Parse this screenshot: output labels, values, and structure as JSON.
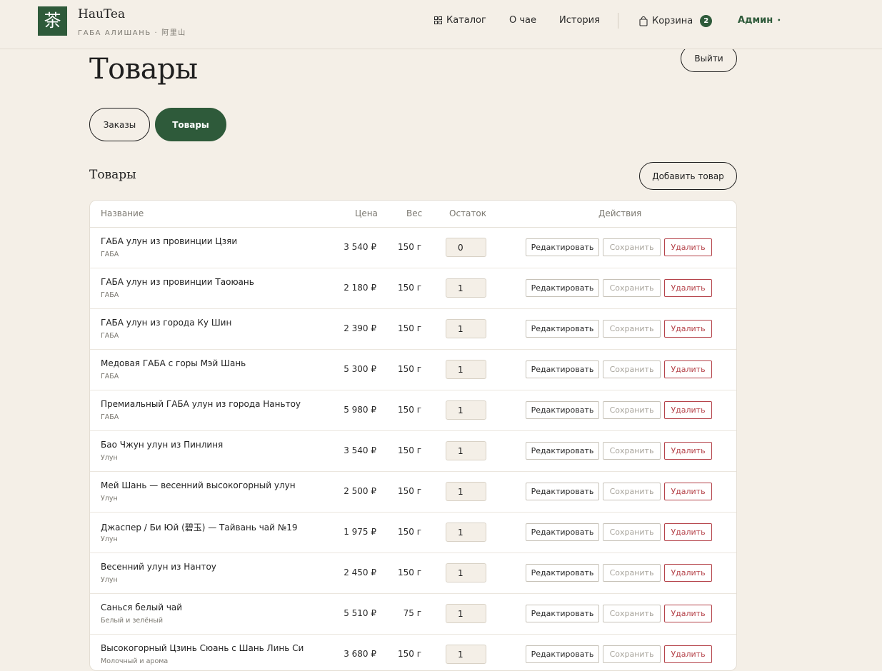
{
  "header": {
    "logo_glyph": "茶",
    "brand_name": "HauTea",
    "brand_sub": "ГАБА АЛИШАНЬ · 阿里山",
    "nav": {
      "catalog": "Каталог",
      "about": "О чае",
      "history": "История",
      "cart": "Корзина",
      "cart_count": "2",
      "admin": "Админ"
    }
  },
  "page": {
    "title": "Товары",
    "logout": "Выйти",
    "tabs": {
      "orders": "Заказы",
      "products": "Товары"
    },
    "section_title": "Товары",
    "add_button": "Добавить товар"
  },
  "table": {
    "headers": {
      "name": "Название",
      "price": "Цена",
      "weight": "Вес",
      "stock": "Остаток",
      "actions": "Действия"
    },
    "action_labels": {
      "edit": "Редактировать",
      "save": "Сохранить",
      "delete": "Удалить"
    },
    "rows": [
      {
        "name": "ГАБА улун из провинции Цзяи",
        "category": "ГАБА",
        "price": "3 540 ₽",
        "weight": "150 г",
        "stock": "0"
      },
      {
        "name": "ГАБА улун из провинции Таоюань",
        "category": "ГАБА",
        "price": "2 180 ₽",
        "weight": "150 г",
        "stock": "1"
      },
      {
        "name": "ГАБА улун из города Ку Шин",
        "category": "ГАБА",
        "price": "2 390 ₽",
        "weight": "150 г",
        "stock": "1"
      },
      {
        "name": "Медовая ГАБА с горы Мэй Шань",
        "category": "ГАБА",
        "price": "5 300 ₽",
        "weight": "150 г",
        "stock": "1"
      },
      {
        "name": "Премиальный ГАБА улун из города Наньтоу",
        "category": "ГАБА",
        "price": "5 980 ₽",
        "weight": "150 г",
        "stock": "1"
      },
      {
        "name": "Бао Чжун улун из Пинлиня",
        "category": "Улун",
        "price": "3 540 ₽",
        "weight": "150 г",
        "stock": "1"
      },
      {
        "name": "Мей Шань — весенний высокогорный улун",
        "category": "Улун",
        "price": "2 500 ₽",
        "weight": "150 г",
        "stock": "1"
      },
      {
        "name": "Джаспер / Би Юй (碧玉) — Тайвань чай №19",
        "category": "Улун",
        "price": "1 975 ₽",
        "weight": "150 г",
        "stock": "1"
      },
      {
        "name": "Весенний улун из Нантоу",
        "category": "Улун",
        "price": "2 450 ₽",
        "weight": "150 г",
        "stock": "1"
      },
      {
        "name": "Санься белый чай",
        "category": "Белый и зелёный",
        "price": "5 510 ₽",
        "weight": "75 г",
        "stock": "1"
      },
      {
        "name": "Высокогорный Цзинь Сюань с Шань Линь Си",
        "category": "Молочный и арома",
        "price": "3 680 ₽",
        "weight": "150 г",
        "stock": "1"
      }
    ]
  }
}
